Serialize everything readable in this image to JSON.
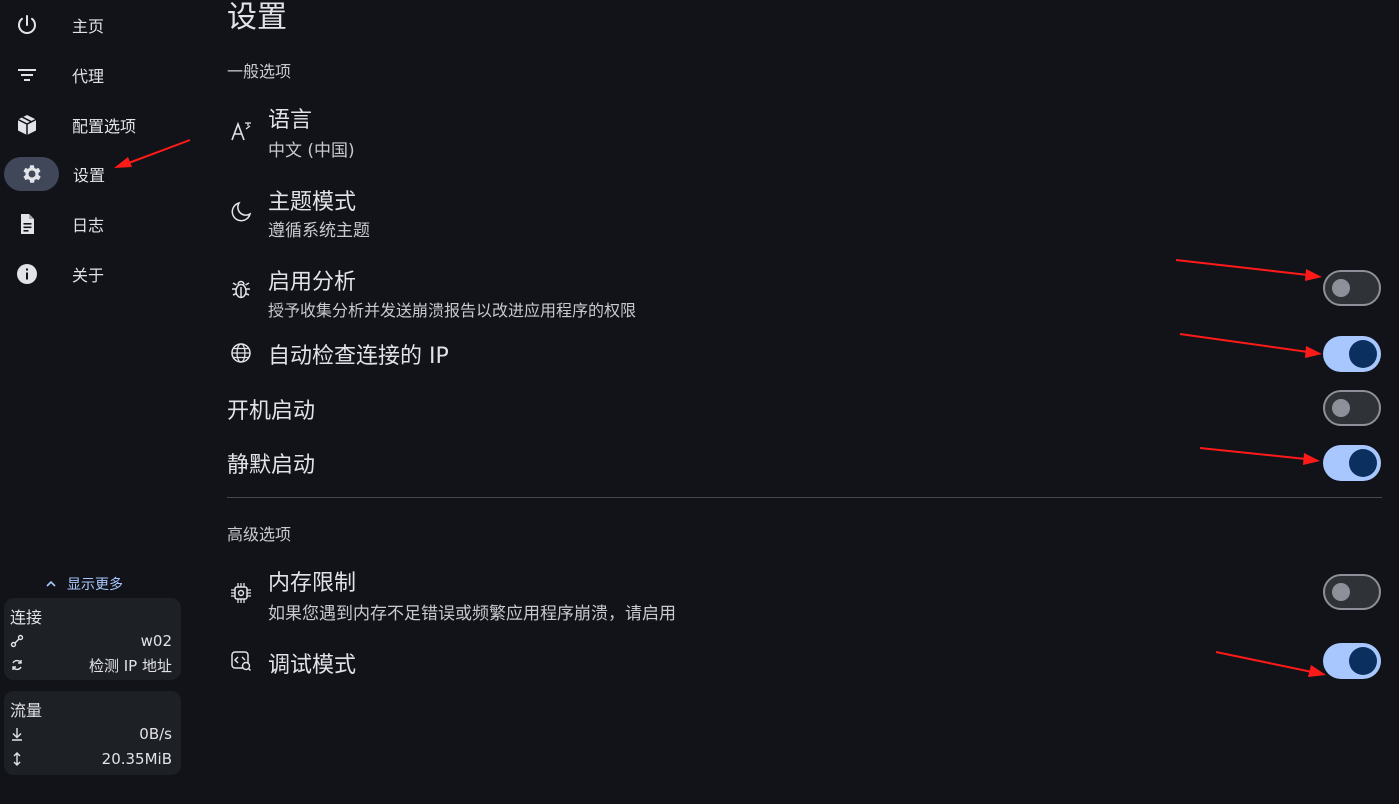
{
  "sidebar": {
    "items": [
      {
        "label": "主页",
        "icon": "power-icon"
      },
      {
        "label": "代理",
        "icon": "filter-list-icon"
      },
      {
        "label": "配置选项",
        "icon": "package-icon"
      },
      {
        "label": "设置",
        "icon": "gear-icon",
        "active": true
      },
      {
        "label": "日志",
        "icon": "document-icon"
      },
      {
        "label": "关于",
        "icon": "info-icon"
      }
    ],
    "show_more": "显示更多",
    "connection": {
      "title": "连接",
      "profile": "w02",
      "detect_ip": "检测 IP 地址"
    },
    "traffic": {
      "title": "流量",
      "speed": "0B/s",
      "total": "20.35MiB"
    }
  },
  "main": {
    "title": "设置",
    "general": {
      "title": "一般选项",
      "language": {
        "title": "语言",
        "value": "中文 (中国)",
        "icon": "translate-icon"
      },
      "theme": {
        "title": "主题模式",
        "value": "遵循系统主题",
        "icon": "moon-icon"
      },
      "analytics": {
        "title": "启用分析",
        "desc": "授予收集分析并发送崩溃报告以改进应用程序的权限",
        "icon": "bug-icon",
        "enabled": false
      },
      "auto_check_ip": {
        "title": "自动检查连接的 IP",
        "icon": "globe-icon",
        "enabled": true
      },
      "launch_at_startup": {
        "title": "开机启动",
        "enabled": false
      },
      "silent_start": {
        "title": "静默启动",
        "enabled": true
      }
    },
    "advanced": {
      "title": "高级选项",
      "memory_limit": {
        "title": "内存限制",
        "desc": "如果您遇到内存不足错误或频繁应用程序崩溃，请启用",
        "icon": "chip-icon",
        "enabled": false
      },
      "debug_mode": {
        "title": "调试模式",
        "icon": "debug-icon",
        "enabled": true
      }
    }
  },
  "colors": {
    "background": "#111318",
    "accent": "#a9c7ff",
    "toggle_knob_on": "#0b305f",
    "annotation_arrow": "#ff1a1a"
  }
}
